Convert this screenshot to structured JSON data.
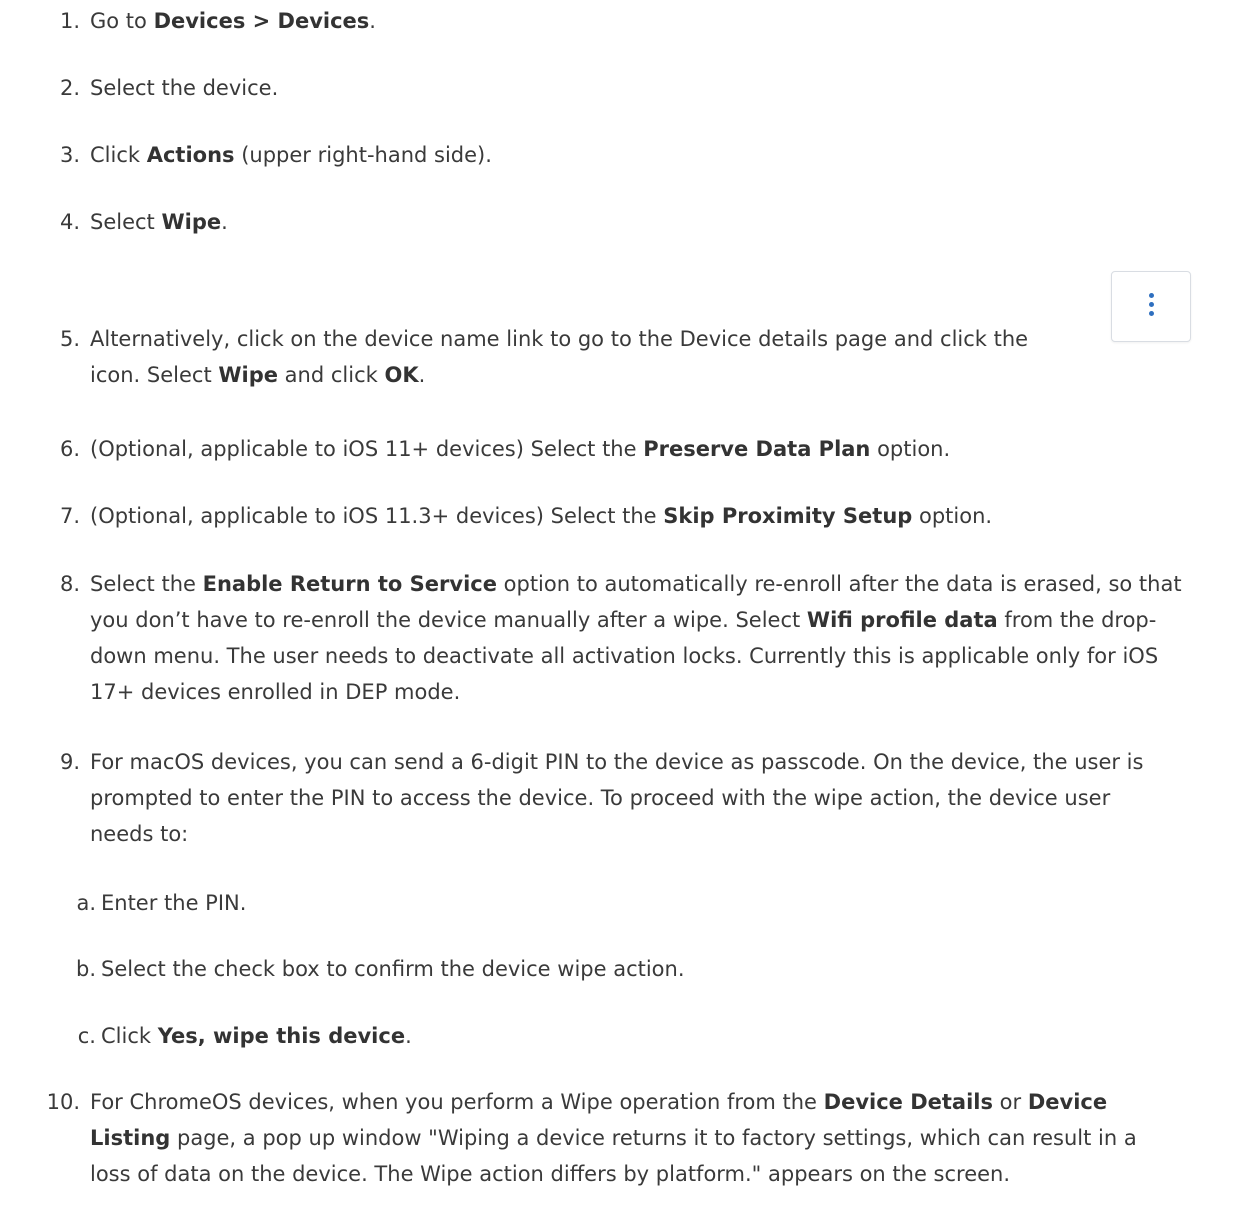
{
  "steps": [
    {
      "num": "1.",
      "pre": "Go to ",
      "b1": "Devices > Devices",
      "post": "."
    },
    {
      "num": "2.",
      "text": "Select the device."
    },
    {
      "num": "3.",
      "pre": "Click ",
      "b1": "Actions",
      "post": " (upper right-hand side)."
    },
    {
      "num": "4.",
      "pre": "Select ",
      "b1": "Wipe",
      "post": "."
    },
    {
      "num": "5.",
      "line1": "Alternatively, click on the device name link to go to the Device details page and click the",
      "l2_pre": "icon. Select ",
      "l2_b1": "Wipe",
      "l2_mid": " and click ",
      "l2_b2": "OK",
      "l2_post": "."
    },
    {
      "num": "6.",
      "pre": "(Optional, applicable to iOS 11+ devices) Select the ",
      "b1": "Preserve Data Plan",
      "post": " option."
    },
    {
      "num": "7.",
      "pre": "(Optional, applicable to iOS 11.3+ devices) Select the ",
      "b1": "Skip Proximity Setup",
      "post": " option."
    },
    {
      "num": "8.",
      "l1_pre": "Select the ",
      "l1_b": "Enable Return to Service",
      "l1_post": " option to automatically re-enroll after the data is erased, so that",
      "l2_pre": "you don’t have to re-enroll the device manually after a wipe. Select ",
      "l2_b": "Wifi profile data",
      "l2_post": " from the drop-",
      "line3": "down menu. The user needs to deactivate all activation locks. Currently this is applicable only for iOS",
      "line4": "17+ devices enrolled in DEP mode."
    },
    {
      "num": "9.",
      "line1": "For macOS devices, you can send a 6-digit PIN to the device as passcode. On the device, the user is",
      "line2": "prompted to enter the PIN to access the device. To proceed with the wipe action, the device user",
      "line3": "needs to:",
      "subs": [
        {
          "letter": "a.",
          "text": "Enter the PIN."
        },
        {
          "letter": "b.",
          "text": "Select the check box to confirm the device wipe action."
        },
        {
          "letter": "c.",
          "pre": "Click ",
          "b1": "Yes, wipe this device",
          "post": "."
        }
      ]
    },
    {
      "num": "10.",
      "l1_pre": "For ChromeOS devices, when you perform a Wipe operation from the ",
      "l1_b1": "Device Details",
      "l1_mid": " or ",
      "l1_b2": "Device",
      "l2_b": "Listing",
      "l2_post": " page, a pop up window \"Wiping a device returns it to factory settings, which can result in a",
      "line3": "loss of data on the device. The Wipe action differs by platform.\" appears on the screen."
    }
  ],
  "icons": {
    "more_actions": "vertical-ellipsis-icon"
  },
  "colors": {
    "text": "#3a3a3a",
    "icon_dots": "#2f6fbf",
    "icon_border": "#d9dde3"
  }
}
